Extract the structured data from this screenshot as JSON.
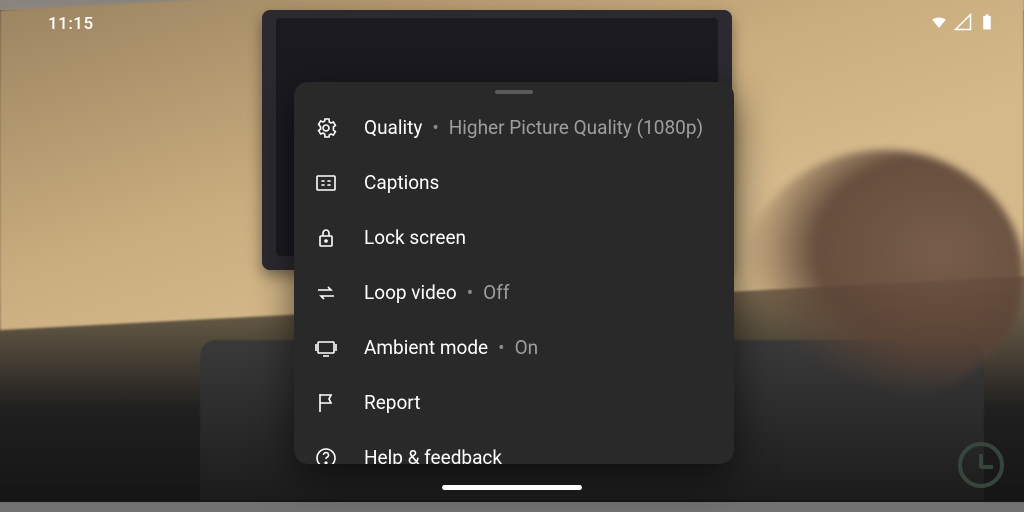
{
  "statusbar": {
    "time": "11:15"
  },
  "menu": {
    "quality": {
      "label": "Quality",
      "value": "Higher Picture Quality (1080p)"
    },
    "captions": {
      "label": "Captions"
    },
    "lock": {
      "label": "Lock screen"
    },
    "loop": {
      "label": "Loop video",
      "value": "Off"
    },
    "ambient": {
      "label": "Ambient mode",
      "value": "On"
    },
    "report": {
      "label": "Report"
    },
    "help": {
      "label": "Help & feedback"
    }
  },
  "separator": "•"
}
